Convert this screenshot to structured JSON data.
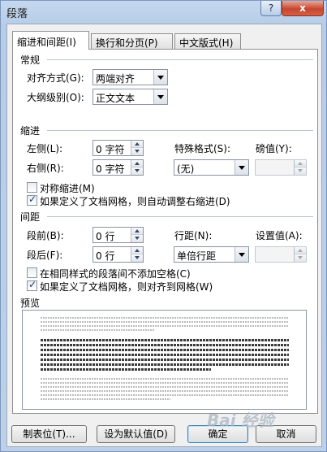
{
  "window": {
    "title": "段落",
    "help_label": "?",
    "close_label": "x"
  },
  "tabs": [
    {
      "label": "缩进和间距(I)",
      "active": true
    },
    {
      "label": "换行和分页(P)",
      "active": false
    },
    {
      "label": "中文版式(H)",
      "active": false
    }
  ],
  "general": {
    "title": "常规",
    "alignment_label": "对齐方式(G):",
    "alignment_value": "两端对齐",
    "outline_label": "大纲级别(O):",
    "outline_value": "正文文本"
  },
  "indent": {
    "title": "缩进",
    "left_label": "左侧(L):",
    "left_value": "0 字符",
    "right_label": "右侧(R):",
    "right_value": "0 字符",
    "special_label": "特殊格式(S):",
    "special_value": "(无)",
    "by_label": "磅值(Y):",
    "by_value": "",
    "mirror_label": "对称缩进(M)",
    "mirror_checked": false,
    "grid_label": "如果定义了文档网格，则自动调整右缩进(D)",
    "grid_checked": true
  },
  "spacing": {
    "title": "间距",
    "before_label": "段前(B):",
    "before_value": "0 行",
    "after_label": "段后(F):",
    "after_value": "0 行",
    "line_label": "行距(N):",
    "line_value": "单倍行距",
    "at_label": "设置值(A):",
    "at_value": "",
    "no_space_label": "在相同样式的段落间不添加空格(C)",
    "no_space_checked": false,
    "snap_label": "如果定义了文档网格，则对齐到网格(W)",
    "snap_checked": true
  },
  "preview": {
    "title": "预览"
  },
  "buttons": {
    "tabs": "制表位(T)...",
    "default": "设为默认值(D)",
    "ok": "确定",
    "cancel": "取消"
  },
  "watermark": "Bai 经验"
}
